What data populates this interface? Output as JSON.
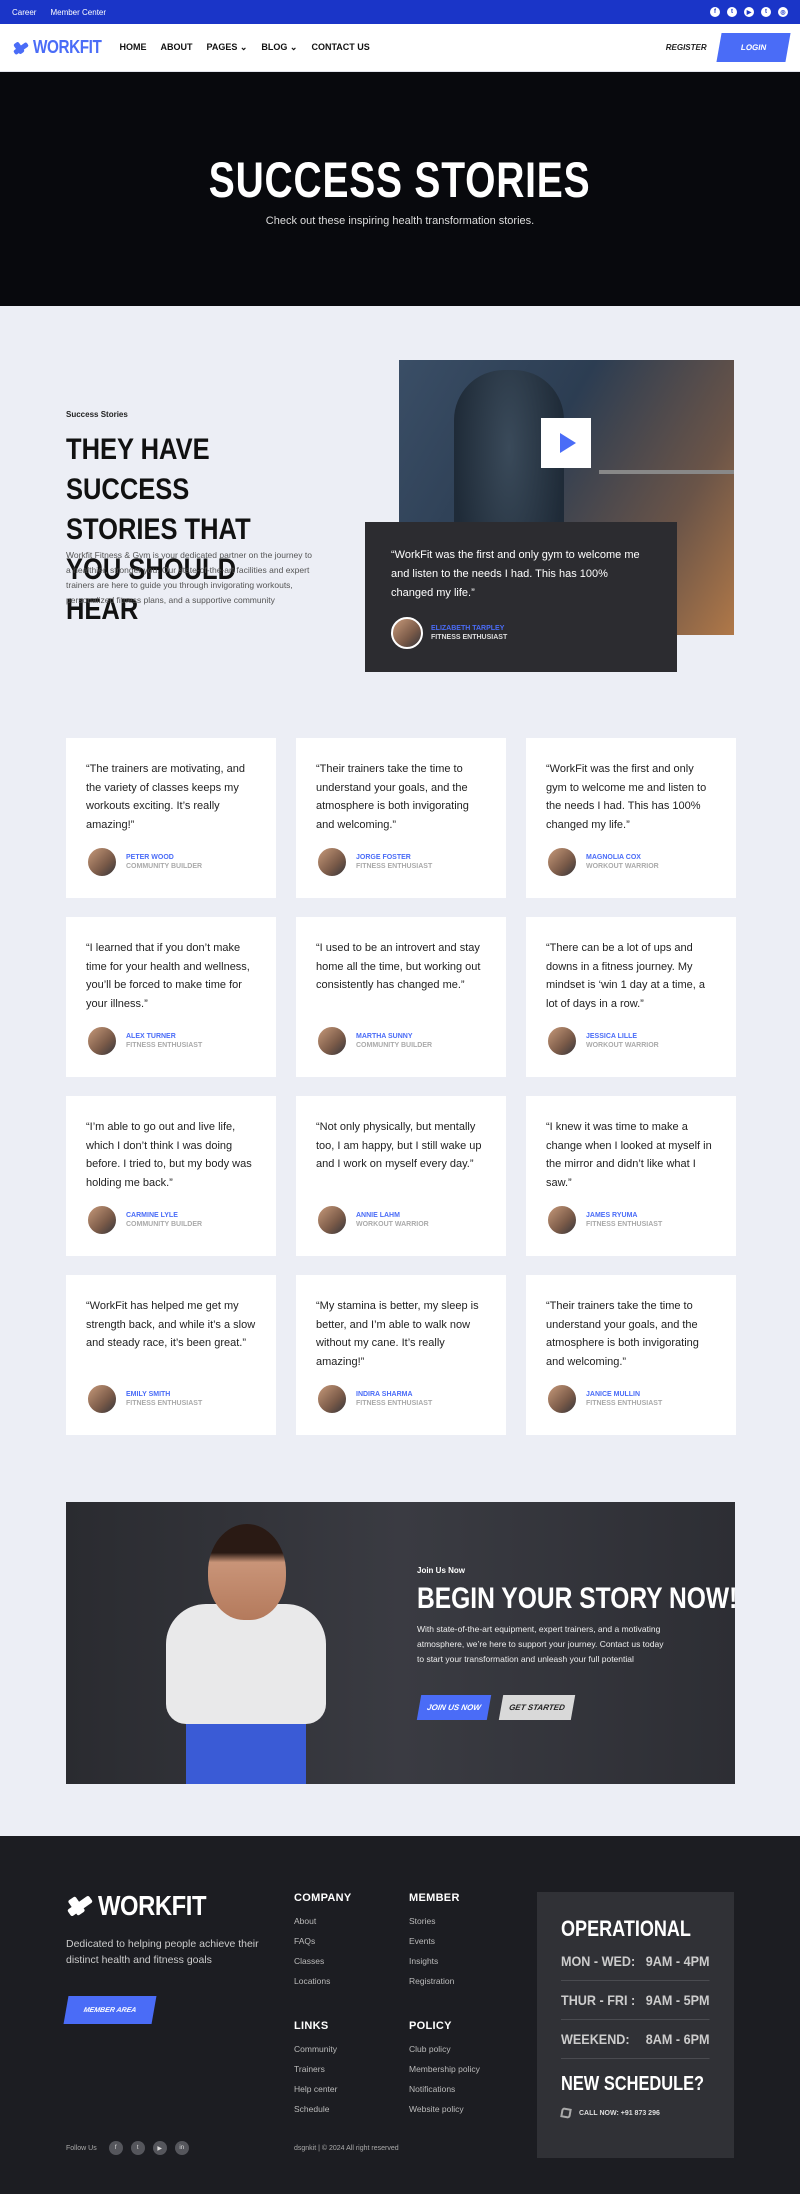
{
  "topbar": {
    "links": [
      "Career",
      "Member Center"
    ],
    "social_icons": [
      "facebook-icon",
      "twitter-icon",
      "youtube-icon",
      "twitter-icon",
      "instagram-icon"
    ]
  },
  "nav": {
    "logo": "WORKFIT",
    "menu": [
      "Home",
      "About",
      "Pages",
      "Blog",
      "Contact Us"
    ],
    "register": "REGISTER",
    "login": "LOGIN"
  },
  "hero": {
    "title": "SUCCESS STORIES",
    "subtitle": "Check out these inspiring health transformation stories."
  },
  "intro": {
    "eyebrow": "Success Stories",
    "heading": "THEY HAVE SUCCESS STORIES THAT YOU SHOULD HEAR",
    "description": "Workfit Fitness & Gym is your dedicated partner on the journey to a healthier, stronger you. Our state-of-the-art facilities and expert trainers are here to guide you through invigorating workouts, personalized fitness plans, and a supportive community",
    "featured_quote": "“WorkFit was the first and only gym to welcome me and listen to the needs I had. This has 100% changed my life.”",
    "featured_name": "Elizabeth Tarpley",
    "featured_role": "Fitness Enthusiast"
  },
  "testimonials": [
    {
      "quote": "“The trainers are motivating, and the variety of classes keeps my workouts exciting. It’s really amazing!”",
      "name": "Peter Wood",
      "role": "Community Builder"
    },
    {
      "quote": "“Their trainers take the time to understand your goals, and the atmosphere is both invigorating and welcoming.”",
      "name": "Jorge Foster",
      "role": "Fitness Enthusiast"
    },
    {
      "quote": "“WorkFit was the first and only gym to welcome me and listen to the needs I had. This has 100% changed my life.”",
      "name": "Magnolia Cox",
      "role": "Workout Warrior"
    },
    {
      "quote": "“I learned that if you don’t make time for your health and wellness, you’ll be forced to make time for your illness.”",
      "name": "Alex Turner",
      "role": "Fitness Enthusiast"
    },
    {
      "quote": "“I used to be an introvert and stay home all the time, but working out consistently has changed me.”",
      "name": "Martha Sunny",
      "role": "Community Builder"
    },
    {
      "quote": "“There can be a lot of ups and downs in a fitness journey. My mindset is ‘win 1 day at a time, a lot of days in a row.”",
      "name": "Jessica Lille",
      "role": "Workout Warrior"
    },
    {
      "quote": "“I’m able to go out and live life, which I don’t think I was doing before. I tried to, but my body was holding me back.”",
      "name": "Carmine Lyle",
      "role": "Community Builder"
    },
    {
      "quote": "“Not only physically, but mentally too, I am happy, but I still wake up and I work on myself every day.”",
      "name": "Annie Lahm",
      "role": "Workout Warrior"
    },
    {
      "quote": "“I knew it was time to make a change when I looked at myself in the mirror and didn’t like what I saw.”",
      "name": "James Ryuma",
      "role": "Fitness Enthusiast"
    },
    {
      "quote": "“WorkFit has helped me get my strength back, and while it’s a slow and steady race, it’s been great.”",
      "name": "Emily Smith",
      "role": "Fitness Enthusiast"
    },
    {
      "quote": "“My stamina is better, my sleep is better, and I’m able to walk now without my cane. It’s really amazing!”",
      "name": "Indira Sharma",
      "role": "Fitness Enthusiast"
    },
    {
      "quote": "“Their trainers take the time to understand your goals, and the atmosphere is both invigorating and welcoming.”",
      "name": "Janice Mullin",
      "role": "Fitness Enthusiast"
    }
  ],
  "cta": {
    "eyebrow": "Join Us Now",
    "title": "BEGIN YOUR STORY NOW!",
    "description": "With state-of-the-art equipment, expert trainers, and a motivating atmosphere, we’re here to support your journey. Contact us today to start your transformation and unleash your full potential",
    "primary": "JOIN US NOW",
    "secondary": "GET STARTED"
  },
  "footer": {
    "logo": "WORKFIT",
    "tagline": "Dedicated to helping people achieve their distinct health and fitness goals",
    "member_area": "MEMBER AREA",
    "columns": {
      "company": {
        "title": "Company",
        "links": [
          "About",
          "FAQs",
          "Classes",
          "Locations"
        ]
      },
      "member": {
        "title": "Member",
        "links": [
          "Stories",
          "Events",
          "Insights",
          "Registration"
        ]
      },
      "links": {
        "title": "Links",
        "links": [
          "Community",
          "Trainers",
          "Help center",
          "Schedule"
        ]
      },
      "policy": {
        "title": "Policy",
        "links": [
          "Club policy",
          "Membership policy",
          "Notifications",
          "Website policy"
        ]
      }
    },
    "follow": "Follow Us",
    "copyright": "dsgnkit | © 2024 All right reserved",
    "operational": {
      "title": "OPERATIONAL",
      "rows": [
        {
          "day": "MON - WED:",
          "time": "9AM - 4PM"
        },
        {
          "day": "THUR - FRI :",
          "time": "9AM - 5PM"
        },
        {
          "day": "WEEKEND:",
          "time": "8AM - 6PM"
        }
      ],
      "schedule_title": "NEW SCHEDULE?",
      "call": "CALL NOW: +91 873 296"
    }
  }
}
